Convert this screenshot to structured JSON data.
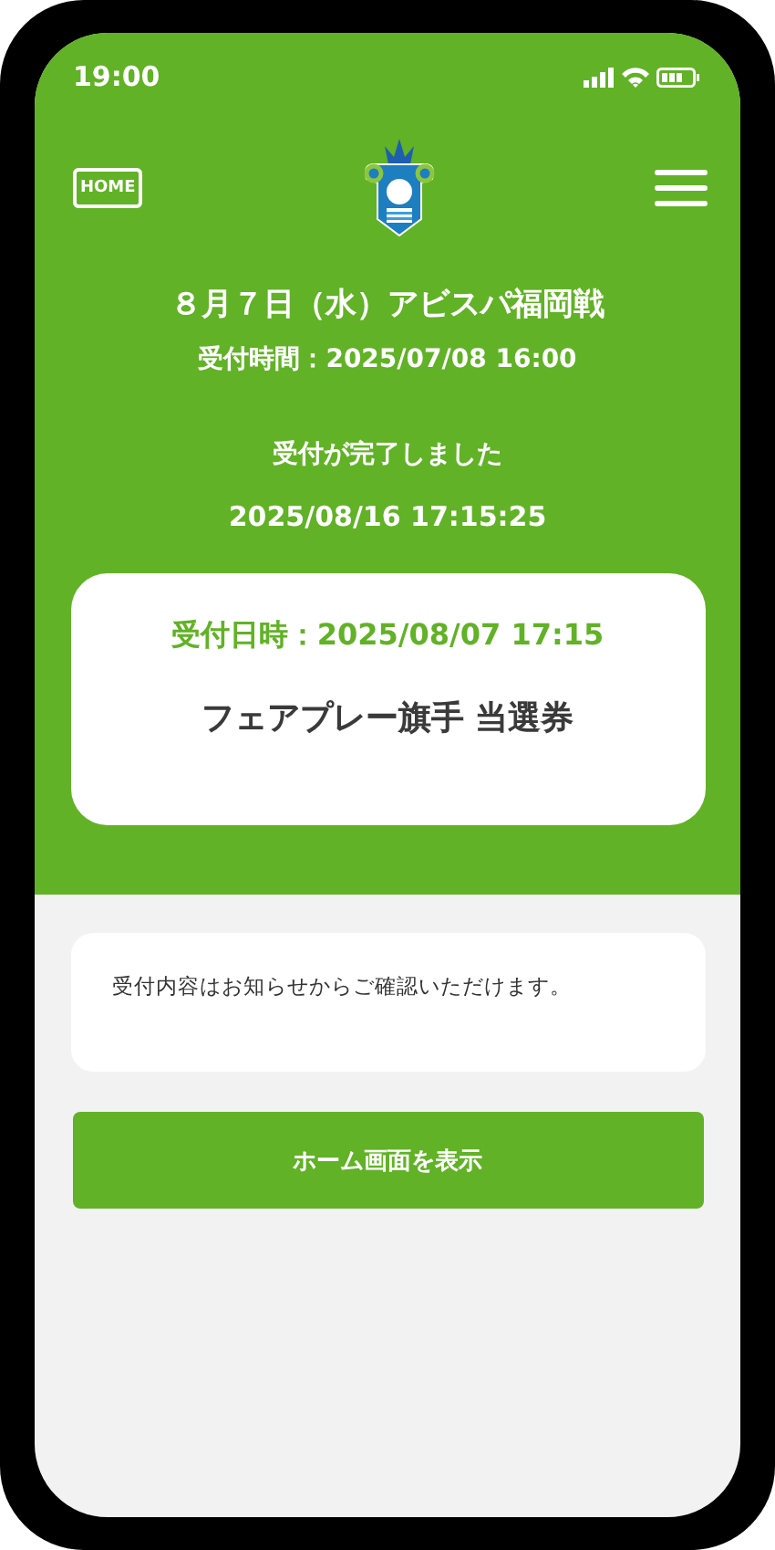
{
  "status_bar": {
    "time": "19:00"
  },
  "header": {
    "home_label": "HOME"
  },
  "match": {
    "title": "８月７日（水）アビスパ福岡戦",
    "reception_time": "受付時間：2025/07/08  16:00"
  },
  "completion": {
    "message": "受付が完了しました",
    "timestamp": "2025/08/16 17:15:25"
  },
  "ticket": {
    "reception_datetime": "受付日時：2025/08/07 17:15",
    "name": "フェアプレー旗手 当選券"
  },
  "notice": "受付内容はお知らせからご確認いただけます。",
  "buttons": [
    {
      "label": "ホーム画面を表示"
    }
  ]
}
